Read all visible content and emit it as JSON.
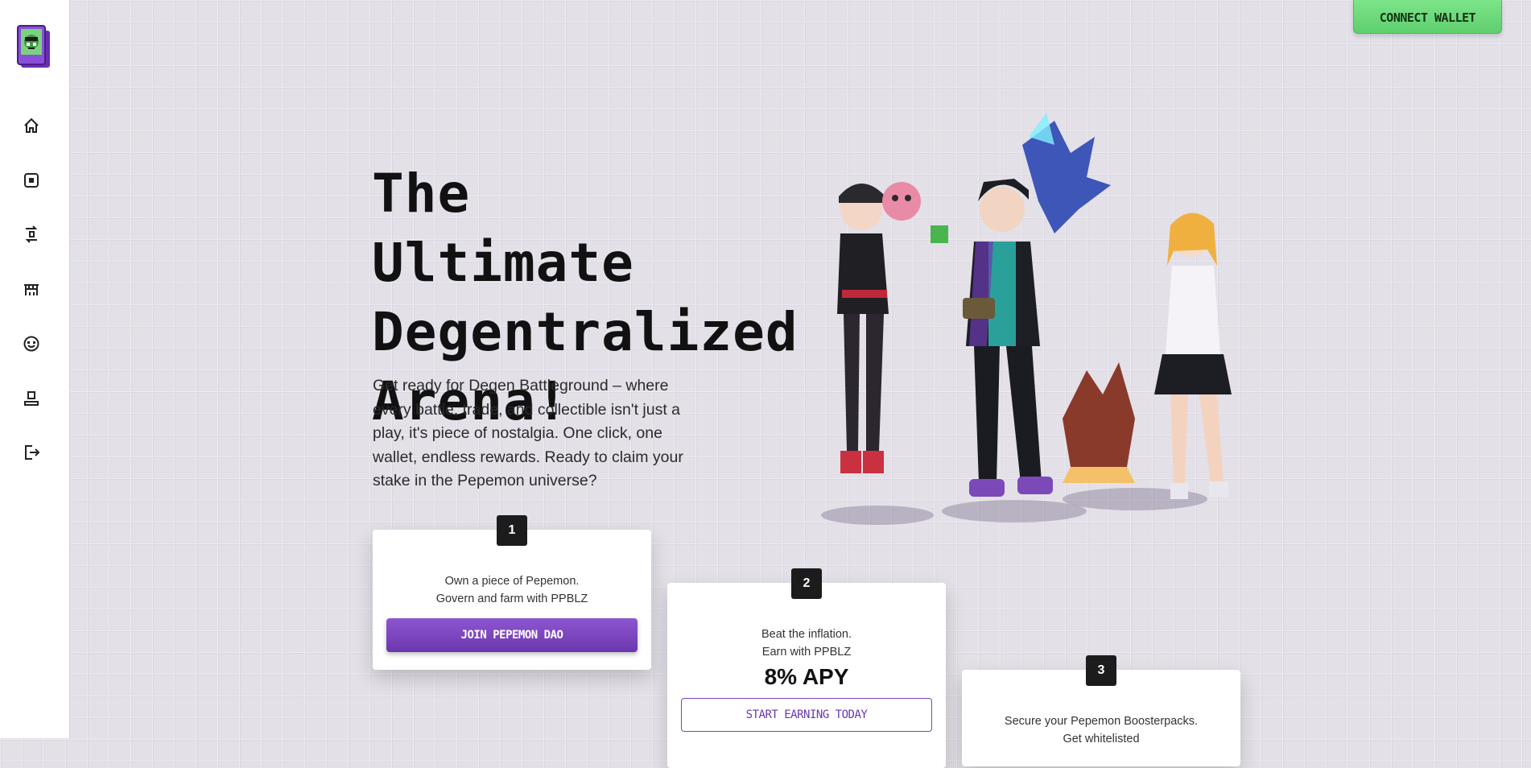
{
  "header": {
    "connect_wallet_label": "CONNECT WALLET"
  },
  "sidebar": {
    "logo": "pepemon-logo",
    "items": [
      {
        "name": "home",
        "icon": "home-icon"
      },
      {
        "name": "cards",
        "icon": "card-icon"
      },
      {
        "name": "exchange",
        "icon": "exchange-icon"
      },
      {
        "name": "store",
        "icon": "store-icon"
      },
      {
        "name": "pepemon",
        "icon": "smiley-icon"
      },
      {
        "name": "profile",
        "icon": "user-icon"
      },
      {
        "name": "logout",
        "icon": "logout-icon"
      }
    ]
  },
  "hero": {
    "title_lines": [
      "The Ultimate",
      "Degentralized",
      "Arena!"
    ],
    "description": "Get ready for Degen Battleground – where every battle, trade, and collectible isn't just a play, it's piece of nostalgia. One click, one wallet, endless rewards. Ready to claim your stake in the Pepemon universe?"
  },
  "steps": [
    {
      "number": "1",
      "lines": [
        "Own a piece of Pepemon.",
        "Govern and farm with PPBLZ"
      ],
      "button_label": "JOIN PEPEMON DAO"
    },
    {
      "number": "2",
      "lines": [
        "Beat the inflation.",
        "Earn with PPBLZ"
      ],
      "highlight": "8% APY",
      "button_label": "START EARNING TODAY"
    },
    {
      "number": "3",
      "lines": [
        "Secure your Pepemon Boosterpacks.",
        "Get whitelisted"
      ]
    }
  ],
  "colors": {
    "accent": "#7a45bd",
    "connect": "#6bd97a",
    "background": "#e3e0e8"
  }
}
